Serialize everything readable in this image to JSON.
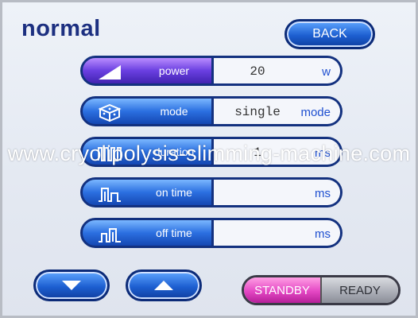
{
  "header": {
    "title": "normal",
    "back_label": "BACK"
  },
  "rows": [
    {
      "icon": "power-ramp-icon",
      "label": "power",
      "value": "20",
      "unit": "w",
      "active": true
    },
    {
      "icon": "mode-cube-icon",
      "label": "mode",
      "value": "single",
      "unit": "mode",
      "active": false
    },
    {
      "icon": "duration-wave-icon",
      "label": "duration",
      "value": "1",
      "unit": "ms",
      "active": false
    },
    {
      "icon": "on-time-pulse-icon",
      "label": "on time",
      "value": "",
      "unit": "ms",
      "active": false
    },
    {
      "icon": "off-time-pulse-icon",
      "label": "off time",
      "value": "",
      "unit": "ms",
      "active": false
    }
  ],
  "footer": {
    "down_icon": "arrow-down-icon",
    "up_icon": "arrow-up-icon",
    "standby_label": "STANDBY",
    "ready_label": "READY"
  },
  "watermark": "www.cryolipolysis-slimming-machine.com",
  "colors": {
    "title": "#1c2f80",
    "button_blue": "#1d5fd1",
    "active_purple": "#6a3fe0",
    "standby_pink": "#e447c4",
    "ready_gray": "#a9acb5"
  }
}
